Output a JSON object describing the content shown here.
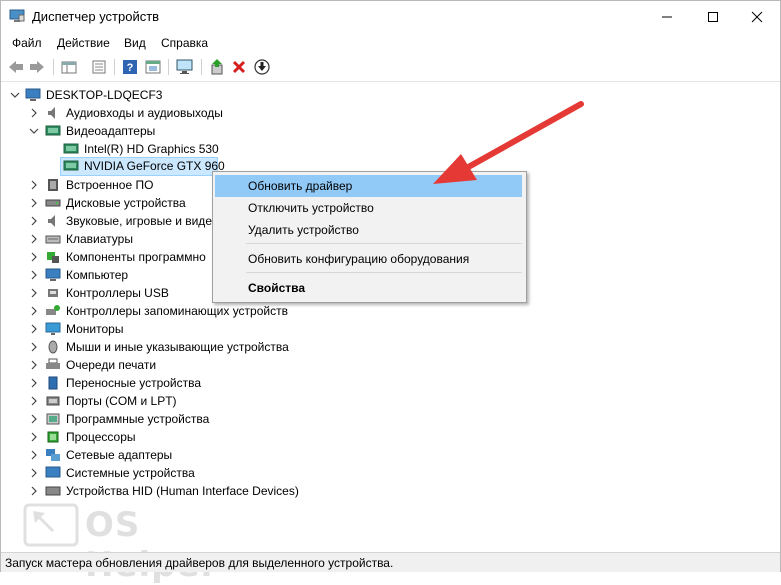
{
  "window": {
    "title": "Диспетчер устройств",
    "minimize_icon": "minimize-icon",
    "maximize_icon": "maximize-icon",
    "close_icon": "close-icon"
  },
  "menu": [
    "Файл",
    "Действие",
    "Вид",
    "Справка"
  ],
  "toolbar": {
    "buttons": [
      "back-arrow-icon",
      "forward-arrow-icon",
      "properties-pane-icon",
      "list-icon",
      "help-icon",
      "console-icon",
      "monitor-scan-icon",
      "update-driver-icon",
      "uninstall-x-icon",
      "download-icon"
    ]
  },
  "tree": {
    "root": "DESKTOP-LDQECF3",
    "items": [
      {
        "label": "Аудиовходы и аудиовыходы",
        "expanded": false
      },
      {
        "label": "Видеоадаптеры",
        "expanded": true
      },
      {
        "label": "Intel(R) HD Graphics 530",
        "child": true
      },
      {
        "label": "NVIDIA GeForce GTX 960",
        "child": true,
        "selected": true
      },
      {
        "label": "Встроенное ПО"
      },
      {
        "label": "Дисковые устройства"
      },
      {
        "label": "Звуковые, игровые и виде"
      },
      {
        "label": "Клавиатуры"
      },
      {
        "label": "Компоненты программно"
      },
      {
        "label": "Компьютер"
      },
      {
        "label": "Контроллеры USB"
      },
      {
        "label": "Контроллеры запоминающих устройств"
      },
      {
        "label": "Мониторы"
      },
      {
        "label": "Мыши и иные указывающие устройства"
      },
      {
        "label": "Очереди печати"
      },
      {
        "label": "Переносные устройства"
      },
      {
        "label": "Порты (COM и LPT)"
      },
      {
        "label": "Программные устройства"
      },
      {
        "label": "Процессоры"
      },
      {
        "label": "Сетевые адаптеры"
      },
      {
        "label": "Системные устройства"
      },
      {
        "label": "Устройства HID (Human Interface Devices)"
      }
    ]
  },
  "context_menu": {
    "update_driver": "Обновить драйвер",
    "disable_device": "Отключить устройство",
    "uninstall_device": "Удалить устройство",
    "scan_hardware": "Обновить конфигурацию оборудования",
    "properties": "Свойства"
  },
  "status": "Запуск мастера обновления драйверов для выделенного устройства.",
  "watermark": "OS Helper",
  "colors": {
    "selection": "#cce8ff",
    "menu_highlight": "#91c9f7",
    "arrow": "#e53935"
  }
}
